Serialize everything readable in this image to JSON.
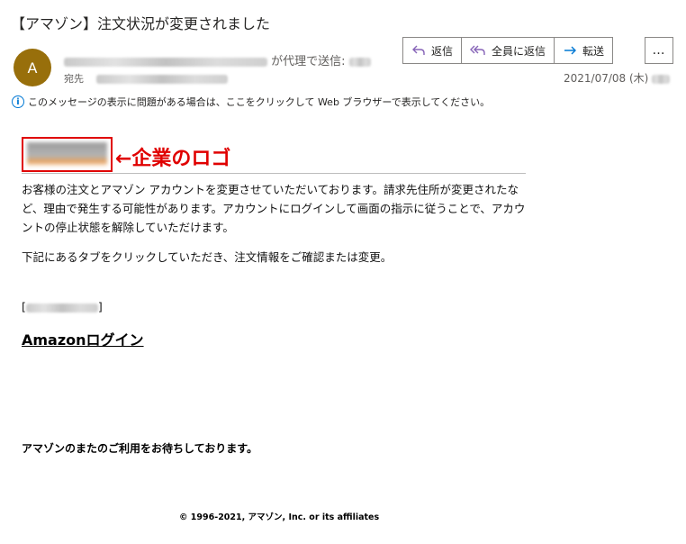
{
  "email": {
    "subject": "【アマゾン】注文状況が変更されました",
    "avatar_initial": "A",
    "sent_on_behalf_label": "が代理で送信:",
    "to_label": "宛先",
    "date": "2021/07/08 (木)",
    "actions": {
      "reply": "返信",
      "reply_all": "全員に返信",
      "forward": "転送",
      "more": "…"
    },
    "info_message": "このメッセージの表示に問題がある場合は、ここをクリックして Web ブラウザーで表示してください。"
  },
  "body": {
    "annotation": "←企業のロゴ",
    "paragraph1": "お客様の注文とアマゾン アカウントを変更させていただいております。請求先住所が変更されたなど、理由で発生する可能性があります。アカウントにログインして画面の指示に従うことで、アカウントの停止状態を解除していただけます。",
    "paragraph2": "下記にあるタブをクリックしていただき、注文情報をご確認または変更。",
    "bracket_open": "[",
    "bracket_close": "]",
    "login_link": "Amazonログイン",
    "closing": "アマゾンのまたのご利用をお待ちしております。",
    "footer": "© 1996-2021, アマゾン, Inc. or its affiliates"
  }
}
